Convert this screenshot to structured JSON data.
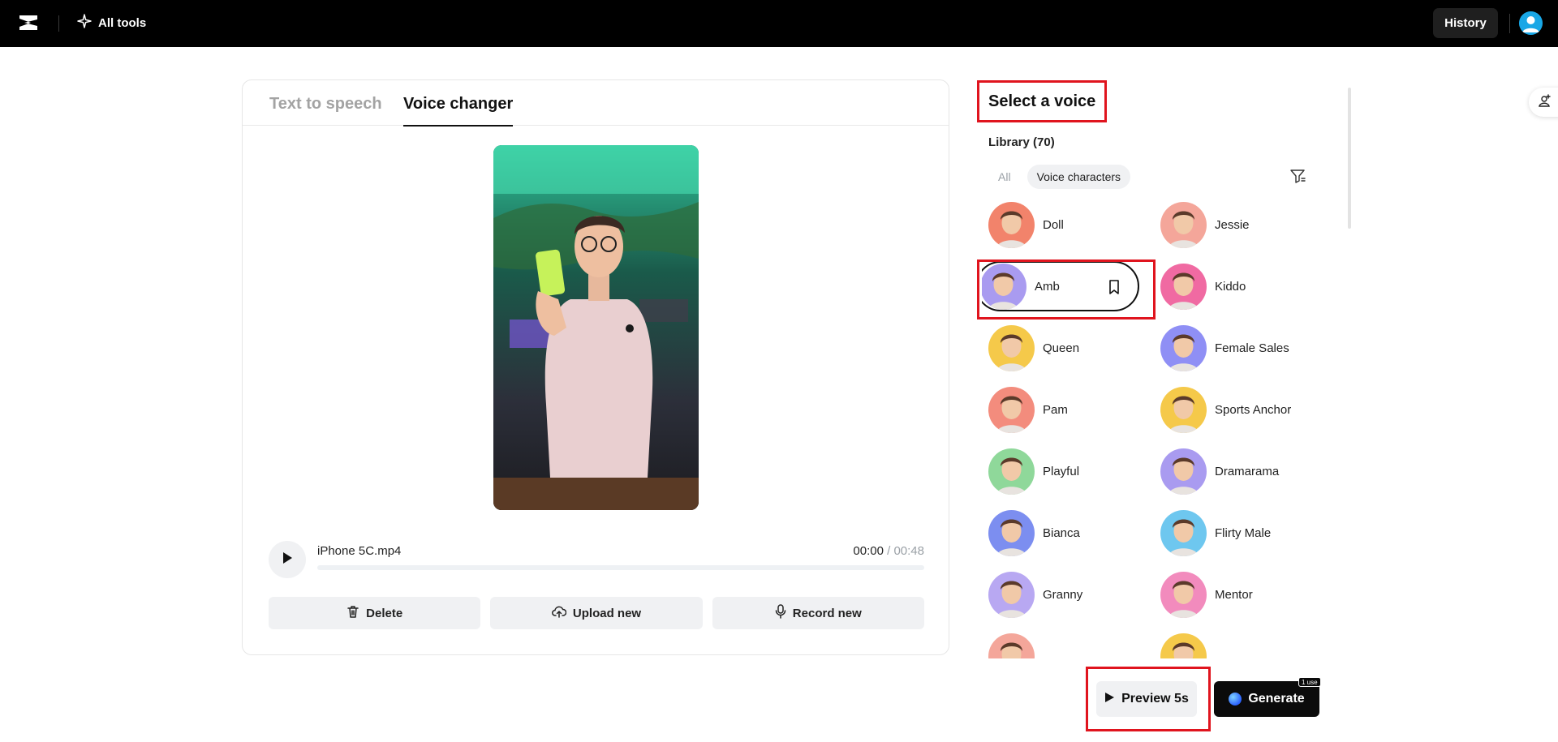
{
  "topbar": {
    "all_tools_label": "All tools",
    "history_label": "History"
  },
  "editor": {
    "tabs": [
      {
        "label": "Text to speech",
        "active": false
      },
      {
        "label": "Voice changer",
        "active": true
      }
    ],
    "player": {
      "file_name": "iPhone 5C.mp4",
      "current_time": "00:00",
      "separator": "/",
      "duration": "00:48",
      "progress": 0
    },
    "actions": {
      "delete_label": "Delete",
      "upload_label": "Upload new",
      "record_label": "Record new"
    }
  },
  "voice_panel": {
    "title": "Select a voice",
    "library_label": "Library (70)",
    "filters": [
      {
        "label": "All",
        "active": false
      },
      {
        "label": "Voice characters",
        "active": true
      }
    ],
    "voices": [
      {
        "name": "Doll",
        "color": "#f2836b",
        "column": 0
      },
      {
        "name": "Jessie",
        "color": "#f4a69a",
        "column": 1
      },
      {
        "name": "Amb",
        "color": "#a99bf0",
        "column": 0,
        "selected": true
      },
      {
        "name": "Kiddo",
        "color": "#f06aa2",
        "column": 1
      },
      {
        "name": "Queen",
        "color": "#f5c94a",
        "column": 0
      },
      {
        "name": "Female Sales",
        "color": "#8f8ff5",
        "column": 1
      },
      {
        "name": "Pam",
        "color": "#f38c7d",
        "column": 0
      },
      {
        "name": "Sports Anchor",
        "color": "#f5c94a",
        "column": 1
      },
      {
        "name": "Playful",
        "color": "#8fd89a",
        "column": 0
      },
      {
        "name": "Dramarama",
        "color": "#a99bf0",
        "column": 1
      },
      {
        "name": "Bianca",
        "color": "#7c8ef0",
        "column": 0
      },
      {
        "name": "Flirty Male",
        "color": "#6ec7ef",
        "column": 1
      },
      {
        "name": "Granny",
        "color": "#b8a8f2",
        "column": 0
      },
      {
        "name": "Mentor",
        "color": "#f28bbd",
        "column": 1
      },
      {
        "name": "",
        "color": "#f4a69a",
        "column": 0
      },
      {
        "name": "",
        "color": "#f5c94a",
        "column": 1
      }
    ]
  },
  "footer": {
    "preview_label": "Preview 5s",
    "generate_label": "Generate",
    "use_badge": "1 use"
  }
}
